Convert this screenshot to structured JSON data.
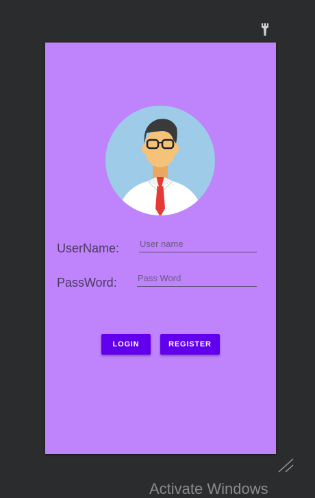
{
  "toolbar": {
    "wrench_icon": "wrench-icon"
  },
  "avatar": {
    "icon": "user-avatar-icon",
    "colors": {
      "circle": "#9ecbe8",
      "skin": "#f5c27a",
      "tie": "#e53935",
      "hair": "#3a3a3a"
    }
  },
  "form": {
    "username": {
      "label": "UserName:",
      "placeholder": "User name",
      "value": ""
    },
    "password": {
      "label": "PassWord:",
      "placeholder": "Pass Word",
      "value": ""
    }
  },
  "buttons": {
    "login": "LOGIN",
    "register": "REGISTER"
  },
  "colors": {
    "background": "#2b2c2e",
    "phone": "#bf83fb",
    "accent": "#6200ee"
  },
  "watermark": "Activate Windows",
  "resize_icon": "resize-handle-icon"
}
